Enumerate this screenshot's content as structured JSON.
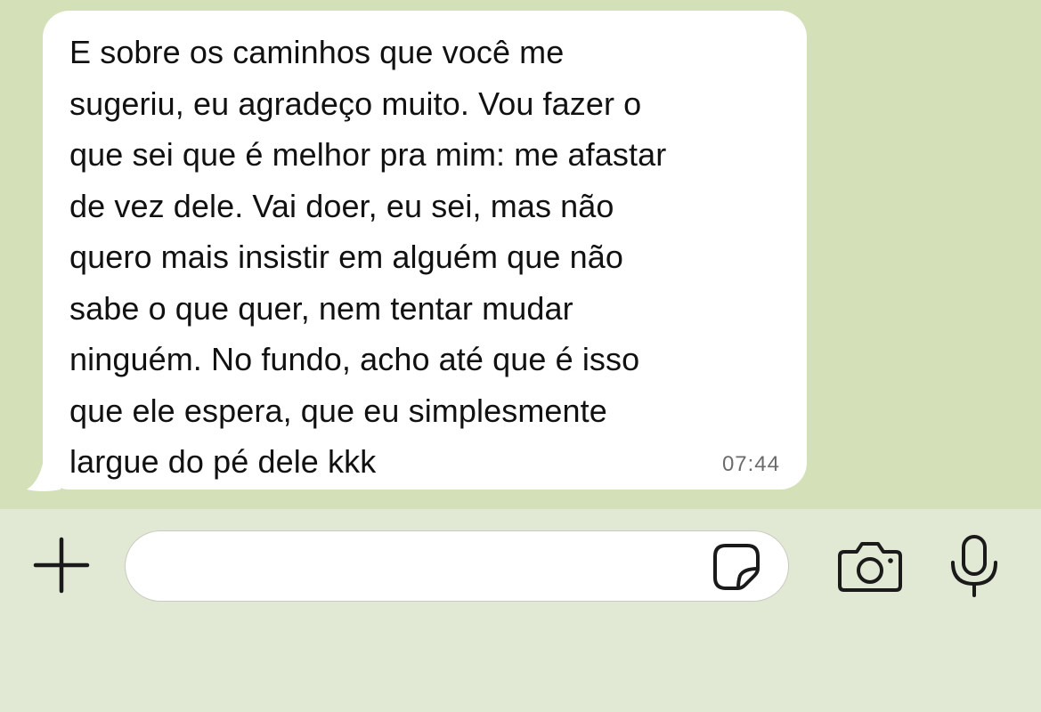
{
  "chat": {
    "message": {
      "text": "E sobre os caminhos que você me\nsugeriu, eu agradeço muito. Vou fazer o\nque sei que é melhor pra mim: me afastar\nde vez dele. Vai doer, eu sei, mas não\nquero mais insistir em alguém que não\nsabe o que quer, nem tentar mudar\nninguém. No fundo, acho até que é isso\nque ele espera, que eu simplesmente\nlargue do pé dele kkk",
      "time": "07:44"
    }
  },
  "composer": {
    "input_value": "",
    "icons": {
      "attach": "plus-icon",
      "sticker": "sticker-icon",
      "camera": "camera-icon",
      "mic": "microphone-icon"
    }
  },
  "colors": {
    "chat_background": "#d3e0b8",
    "bubble": "#ffffff",
    "composer_background": "#e1e8d3",
    "icon": "#1a1a1a"
  }
}
